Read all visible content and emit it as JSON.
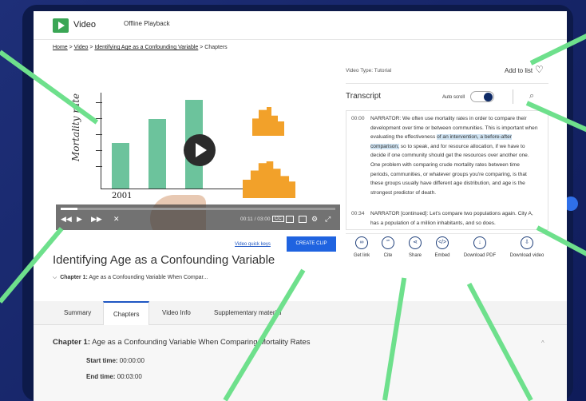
{
  "header": {
    "app_title": "Video",
    "offline_label": "Offline Playback"
  },
  "breadcrumb": {
    "home": "Home",
    "sep": " > ",
    "video": "Video",
    "item": "Identifying Age as a Confounding Variable",
    "current": "Chapters"
  },
  "video": {
    "title": "Identifying Age as a Confounding Variable",
    "chart_ylabel": "Mortality rate",
    "chart_year": "2001",
    "time": "00:11 / 03:00",
    "cc": "CC",
    "progress": 0.06,
    "quick_keys": "Video quick keys",
    "create_clip": "CREATE CLIP"
  },
  "chapter_select": {
    "label": "Chapter 1:",
    "text": "Age as a Confounding Variable When Compar..."
  },
  "tabs": [
    "Summary",
    "Chapters",
    "Video Info",
    "Supplementary material"
  ],
  "active_tab": "Chapters",
  "chapter_panel": {
    "label": "Chapter 1:",
    "title": "Age as a Confounding Variable When Comparing Mortality Rates",
    "start_label": "Start time:",
    "start": "00:00:00",
    "end_label": "End time:",
    "end": "00:03:00"
  },
  "side": {
    "video_type": "Video Type: Tutorial",
    "add_to_list": "Add to list",
    "transcript": "Transcript",
    "auto_scroll": "Auto scroll",
    "entries": [
      {
        "time": "00:00",
        "pre": "NARRATOR: We often use mortality rates in order to compare their development over time or between communities. This is important when evaluating the effectiveness ",
        "hl": "of an intervention, a before-after comparison,",
        "post": " so to speak, and for resource allocation, if we have to decide if one community should get the resources over another one. One problem with comparing crude mortality rates between time periods, communities, or whatever groups you're comparing, is that these groups usually have different age distribution, and age is the strongest predictor of death."
      },
      {
        "time": "00:34",
        "pre": "NARRATOR [continued]: Let's compare two populations again. City A, has a population of a million inhabitants, and so does.",
        "hl": "",
        "post": ""
      }
    ],
    "actions": [
      "Get link",
      "Cite",
      "Share",
      "Embed",
      "Download PDF",
      "Download video"
    ]
  }
}
